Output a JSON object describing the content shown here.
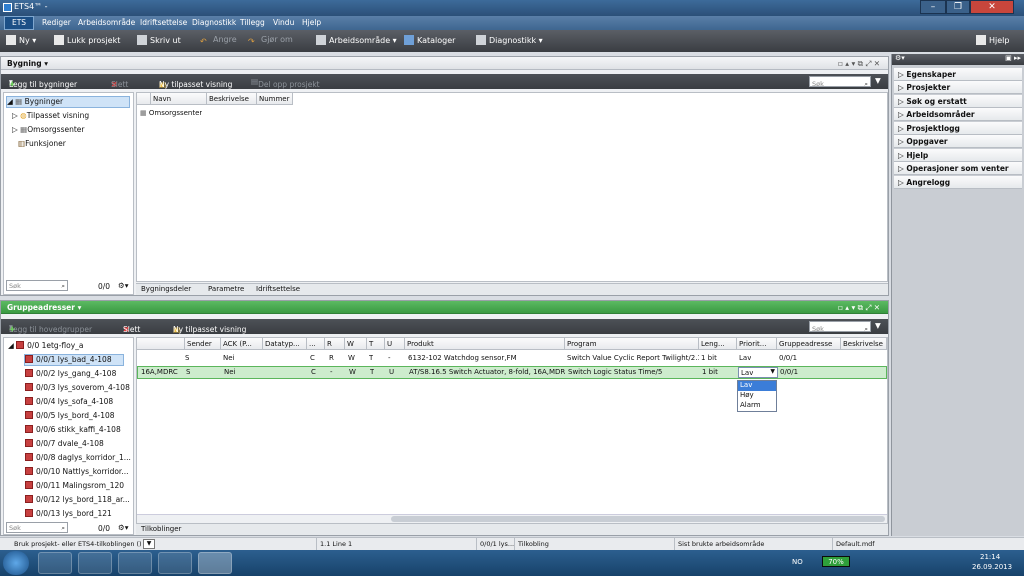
{
  "window": {
    "title": "ETS4™ -"
  },
  "menu": {
    "app_button": "ETS",
    "items": [
      "Rediger",
      "Arbeidsområde",
      "Idriftsettelse",
      "Diagnostikk",
      "Tillegg",
      "Vindu",
      "Hjelp"
    ]
  },
  "toolbar": {
    "new": "Ny",
    "close_project": "Lukk prosjekt",
    "print": "Skriv ut",
    "undo": "Angre",
    "redo": "Gjør om",
    "workspace": "Arbeidsområde",
    "catalogs": "Kataloger",
    "diagnostics": "Diagnostikk",
    "help": "Hjelp"
  },
  "building": {
    "title": "Bygning",
    "add_buildings": "Legg til bygninger",
    "delete": "Slett",
    "custom_view": "Ny tilpasset visning",
    "split_project": "Del opp prosjekt",
    "search_placeholder": "Søk",
    "tree": [
      "Bygninger",
      "Tilpasset visning",
      "Omsorgssenter",
      "Funksjoner"
    ],
    "tree_count": "0/0",
    "columns": [
      "Navn",
      "Beskrivelse",
      "Nummer"
    ],
    "rows": [
      {
        "name": "Omsorgssenter"
      }
    ],
    "tabs": [
      "Bygningsdeler",
      "Parametre",
      "Idriftsettelse"
    ]
  },
  "group_addresses": {
    "title": "Gruppeadresser",
    "add_main_groups": "Legg til hovedgrupper",
    "delete": "Slett",
    "custom_view": "Ny tilpasset visning",
    "search_placeholder": "Søk",
    "tree_root": "0/0 1etg-floy_a",
    "tree_items": [
      "0/0/1 lys_bad_4-108",
      "0/0/2 lys_gang_4-108",
      "0/0/3 lys_soverom_4-108",
      "0/0/4 lys_sofa_4-108",
      "0/0/5 lys_bord_4-108",
      "0/0/6 stikk_kaffi_4-108",
      "0/0/7 dvale_4-108",
      "0/0/8 daglys_korridor_1...",
      "0/0/10 Nattlys_korridor...",
      "0/0/11 Malingsrom_120",
      "0/0/12 lys_bord_118_ar...",
      "0/0/13 lys_bord_121"
    ],
    "tree_count": "0/0",
    "columns": [
      "Sender",
      "ACK (P...",
      "Datatyp...",
      "...",
      "R",
      "W",
      "T",
      "U",
      "Produkt",
      "Program",
      "Leng...",
      "Priorit...",
      "Gruppeadresse",
      "Beskrivelse"
    ],
    "rows": [
      {
        "name": "",
        "sender": "S",
        "ack": "Nei",
        "datatype": "",
        "c": "C",
        "r": "R",
        "w": "W",
        "t": "T",
        "u": "-",
        "product": "6132-102 Watchdog sensor,FM",
        "program": "Switch Value Cyclic Report Twilight/2.1",
        "length": "1 bit",
        "priority": "Lav",
        "address": "0/0/1",
        "description": ""
      },
      {
        "name": "16A,MDRC",
        "sender": "S",
        "ack": "Nei",
        "datatype": "",
        "c": "C",
        "r": "-",
        "w": "W",
        "t": "T",
        "u": "U",
        "product": "AT/S8.16.5 Switch Actuator, 8-fold, 16A,MDRC",
        "program": "Switch Logic Status Time/5",
        "length": "1 bit",
        "priority": "Lav",
        "address": "0/0/1",
        "description": ""
      }
    ],
    "priority_options": [
      "Lav",
      "Høy",
      "Alarm"
    ],
    "tabs": [
      "Tilkoblinger"
    ]
  },
  "properties_pane": {
    "items": [
      "Egenskaper",
      "Prosjekter",
      "Søk og erstatt",
      "Arbeidsområder",
      "Prosjektlogg",
      "Oppgaver",
      "Hjelp",
      "Operasjoner som venter",
      "Angrelogg"
    ]
  },
  "status": {
    "hint": "Bruk prosjekt- eller ETS4-tilkoblingen ()",
    "line": "1.1 Line 1",
    "address": "0/0/1 lys...",
    "connection": "Tilkobling",
    "workspace": "Sist brukte arbeidsområde",
    "file": "Default.mdf"
  },
  "tray": {
    "lang": "NO",
    "battery": "70%",
    "time": "21:14",
    "date": "26.09.2013"
  }
}
